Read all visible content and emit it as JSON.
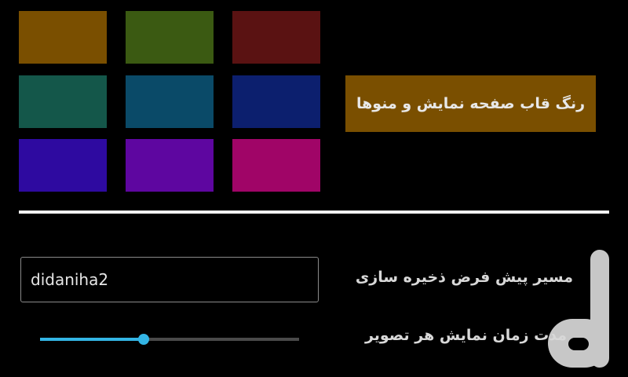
{
  "swatches": {
    "row1": [
      {
        "name": "brown",
        "color": "#7a4f00"
      },
      {
        "name": "olive",
        "color": "#3b5a12"
      },
      {
        "name": "maroon",
        "color": "#5a1212"
      }
    ],
    "row2": [
      {
        "name": "teal-green",
        "color": "#14574a"
      },
      {
        "name": "petrol",
        "color": "#0a4a68"
      },
      {
        "name": "navy",
        "color": "#0c1f6e"
      }
    ],
    "row3": [
      {
        "name": "indigo",
        "color": "#2e0aa0"
      },
      {
        "name": "purple",
        "color": "#5e06a0"
      },
      {
        "name": "magenta",
        "color": "#a00567"
      }
    ]
  },
  "frame_color": {
    "label": "رنگ قاب صفحه نمایش و منوها",
    "color": "#7a4f00"
  },
  "settings": {
    "save_path_label": "مسیر پیش فرض ذخیره سازی",
    "save_path_value": "didaniha2",
    "duration_label": "مدت زمان نمایش هر تصویر",
    "duration_fraction": 0.4,
    "accent_color": "#33b5e5"
  },
  "watermark": {
    "icon": "app-logo-watermark",
    "color": "#ffffff"
  }
}
